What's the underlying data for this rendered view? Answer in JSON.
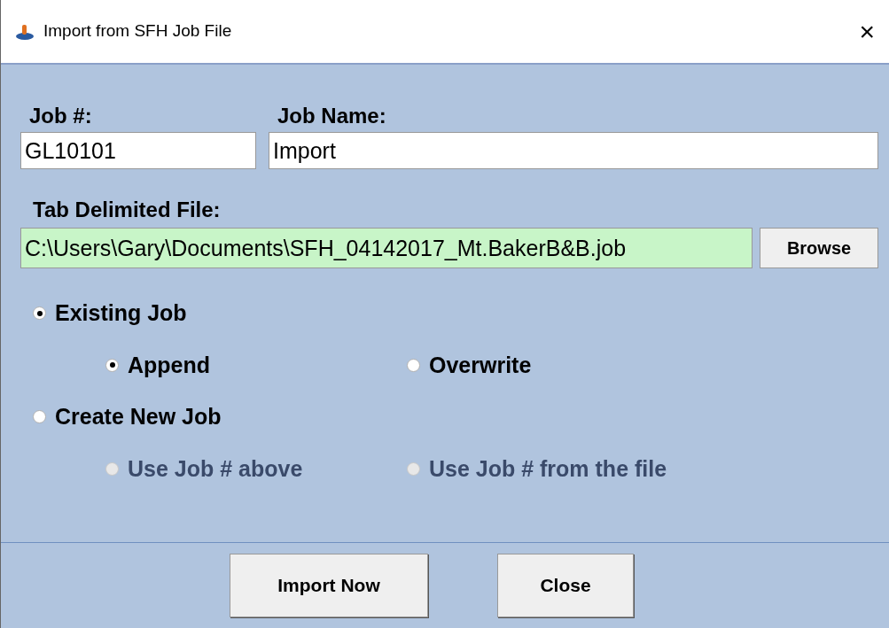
{
  "window": {
    "title": "Import from SFH Job File",
    "close": "×"
  },
  "job_number": {
    "label": "Job #:",
    "value": "GL10101"
  },
  "job_name": {
    "label": "Job Name:",
    "value": "Import"
  },
  "file": {
    "label": "Tab Delimited File:",
    "value": "C:\\Users\\Gary\\Documents\\SFH_04142017_Mt.BakerB&B.job",
    "browse": "Browse"
  },
  "options": [
    {
      "label": "Existing Job",
      "selected": true,
      "disabled": false,
      "children": [
        {
          "label": "Append",
          "selected": true,
          "disabled": false
        },
        {
          "label": "Overwrite",
          "selected": false,
          "disabled": false
        }
      ]
    },
    {
      "label": "Create New Job",
      "selected": false,
      "disabled": false,
      "children": [
        {
          "label": "Use Job # above",
          "selected": false,
          "disabled": true
        },
        {
          "label": "Use Job # from the file",
          "selected": false,
          "disabled": true
        }
      ]
    }
  ],
  "buttons": [
    "Import Now",
    "Close"
  ]
}
